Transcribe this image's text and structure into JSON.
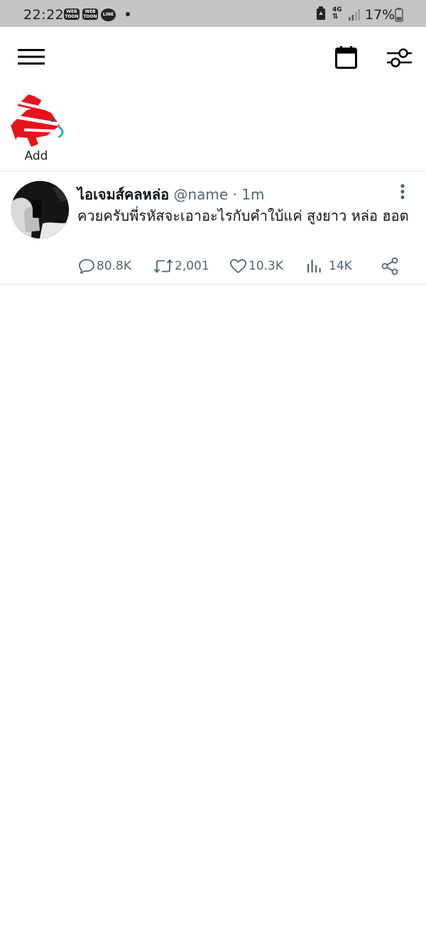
{
  "status_bar": {
    "time": "22:22",
    "notif_webtoon_1": "WEB TOON",
    "notif_webtoon_2": "WEB TOON",
    "notif_line": "LINE",
    "network": "4G",
    "battery": "17%"
  },
  "top_bar": {
    "menu_icon": "hamburger-icon",
    "calendar_icon": "calendar-icon",
    "settings_icon": "sliders-icon"
  },
  "story": {
    "label": "Add"
  },
  "tweet": {
    "display_name": "ไอเจมส์คลหล่อ",
    "handle": "@name",
    "separator": "·",
    "time": "1m",
    "text": "ควยครับพี่รหัสจะเอาอะไรกับคำใบ้แค่ สูงยาว หล่อ ฮอต",
    "replies": "80.8K",
    "retweets": "2,001",
    "likes": "10.3K",
    "views": "14K"
  },
  "colors": {
    "status_bar_bg": "#c4c4c4",
    "meta_gray": "#536471",
    "text_dark": "#0f1419",
    "story_red": "#e8141b"
  }
}
